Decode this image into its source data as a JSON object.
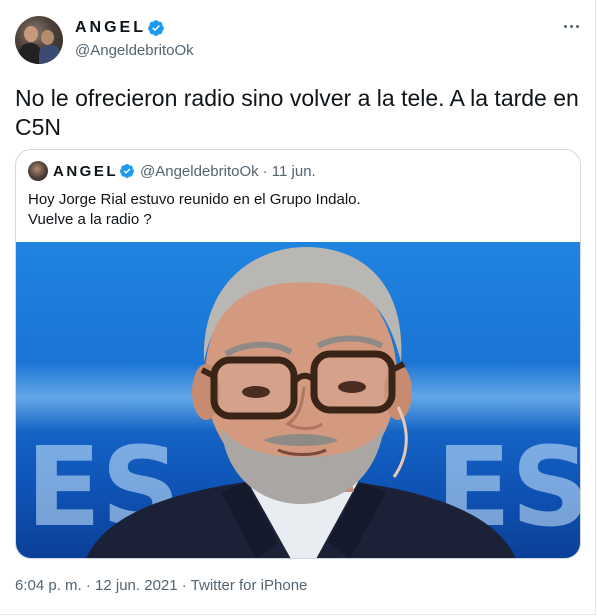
{
  "author": {
    "display_name": "ANGEL",
    "handle": "@AngeldebritoOk",
    "verified": true,
    "avatar_icon": "avatar-photo"
  },
  "tweet": {
    "text": "No le ofrecieron radio sino volver a la tele. A la tarde en C5N",
    "timestamp": "6:04 p. m. · 12 jun. 2021 · Twitter for iPhone"
  },
  "quoted_tweet": {
    "display_name": "ANGEL",
    "handle": "@AngeldebritoOk",
    "date": "· 11 jun.",
    "line1": "Hoy Jorge Rial estuvo reunido en el Grupo Indalo.",
    "line2": "Vuelve a la radio ?"
  },
  "icons": {
    "verified": "verified-badge-icon",
    "more": "more-options-icon"
  },
  "colors": {
    "text": "#0f1419",
    "secondary": "#536471",
    "verified": "#1d9bf0",
    "border": "#cfd9de"
  }
}
